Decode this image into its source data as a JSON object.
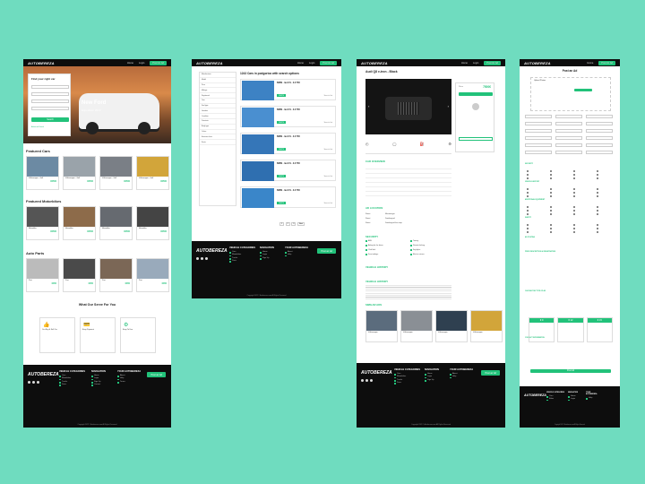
{
  "colors": {
    "background": "#6fdcbf",
    "accent": "#22c27a",
    "dark": "#0d0d0d"
  },
  "brand": "AUTOBEREZA",
  "nav": {
    "link1": "Home",
    "link2": "Login",
    "link3": "Sign Up",
    "post_button": "Post An Ad"
  },
  "home": {
    "search": {
      "title": "Find your right car",
      "button": "Search",
      "advanced": "Advanced Search"
    },
    "hero": {
      "title": "New Ford",
      "subtitle": "Expedition 2022"
    },
    "featured_cars": "Featured Cars",
    "featured_motorbikes": "Featured Motorbikes",
    "auto_parts": "Auto Parts",
    "serve_title": "What Our Serve For You",
    "serve_items": [
      "You Buy & Sell Car",
      "Easy Payment",
      "Easy To Use"
    ]
  },
  "search_page": {
    "title": "1243 Cars in podgorica with search options",
    "filters": [
      "Manufacturer",
      "Model",
      "Price",
      "Mileage",
      "Registered",
      "Year",
      "Fuel type",
      "Gearbox",
      "Condition",
      "Drivetrain",
      "Body type",
      "Colour",
      "Emission class",
      "Seats"
    ],
    "listing_title": "BMW - 4er.8 S - 3.0 TDI",
    "listing_button": "€60370",
    "listing_action": "Save to List",
    "pagination": [
      "1",
      "2",
      "3",
      "Next"
    ]
  },
  "detail": {
    "title": "Audi Q8 e-tron - Black",
    "price_label": "Price",
    "price": "7500€",
    "overview": "CAR OVERVIEW",
    "location": "AD LOCATION",
    "security": "SECURITY",
    "history": "VEHICLE HISTORY",
    "vehicle_history": "VEHICLE HISTORY",
    "similar": "SIMILAR ADS",
    "loc_rows": [
      [
        "Street",
        "Montenegro"
      ],
      [
        "Street",
        "Danilovgrad"
      ],
      [
        "Street",
        "Danilovgrad bus stop"
      ]
    ],
    "features": [
      "ABS",
      "Towing",
      "Airbag for the driver",
      "Remote locking",
      "Child lock",
      "Fog lights",
      "Front airbags",
      "Electric mirrors"
    ]
  },
  "post": {
    "title": "Post an Ad",
    "upload": "Upload Photos",
    "sections": [
      "SECURITY",
      "VEHICLE HISTORY",
      "ADDITIONAL EQUIPMENT",
      "SAFETY",
      "AD POSTING",
      "PRICE DESCRIPTION & REGISTRATION",
      "CHOOSE THE TYPE OF AD",
      "CONTACT INFORMATION"
    ],
    "plans": [
      "€ 9",
      "€ 12",
      "€ 15"
    ],
    "submit": "Post Ad"
  },
  "footer": {
    "col1": "VEHICLE CATEGORIES",
    "col2": "NAVIGATION",
    "col3": "YOUR AUTOBEREZA",
    "cta": "Post an Ad",
    "copyright": "Copyright 2022 © Autobereza.com All Rights Reserved"
  }
}
